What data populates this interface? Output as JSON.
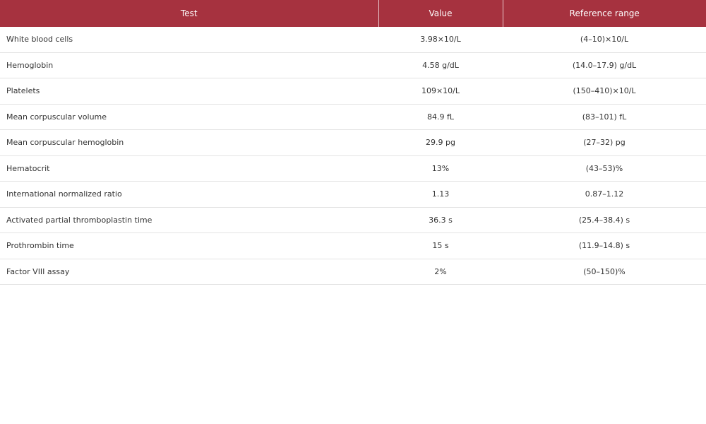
{
  "table": {
    "headers": {
      "test": "Test",
      "value": "Value",
      "reference": "Reference range"
    },
    "rows": [
      {
        "test": "White blood cells",
        "value": "3.98×10/L",
        "reference": "(4–10)×10/L"
      },
      {
        "test": "Hemoglobin",
        "value": "4.58 g/dL",
        "reference": "(14.0–17.9) g/dL"
      },
      {
        "test": "Platelets",
        "value": "109×10/L",
        "reference": "(150–410)×10/L"
      },
      {
        "test": "Mean corpuscular volume",
        "value": "84.9 fL",
        "reference": "(83–101) fL"
      },
      {
        "test": "Mean corpuscular hemoglobin",
        "value": "29.9 pg",
        "reference": "(27–32) pg"
      },
      {
        "test": "Hematocrit",
        "value": "13%",
        "reference": "(43–53)%"
      },
      {
        "test": "International normalized ratio",
        "value": "1.13",
        "reference": "0.87–1.12"
      },
      {
        "test": "Activated partial thromboplastin time",
        "value": "36.3 s",
        "reference": "(25.4–38.4) s"
      },
      {
        "test": "Prothrombin time",
        "value": "15 s",
        "reference": "(11.9–14.8) s"
      },
      {
        "test": "Factor VIII assay",
        "value": "2%",
        "reference": "(50–150)%"
      }
    ]
  },
  "colors": {
    "header_background": "#a6323f",
    "header_text": "#ffffff"
  }
}
